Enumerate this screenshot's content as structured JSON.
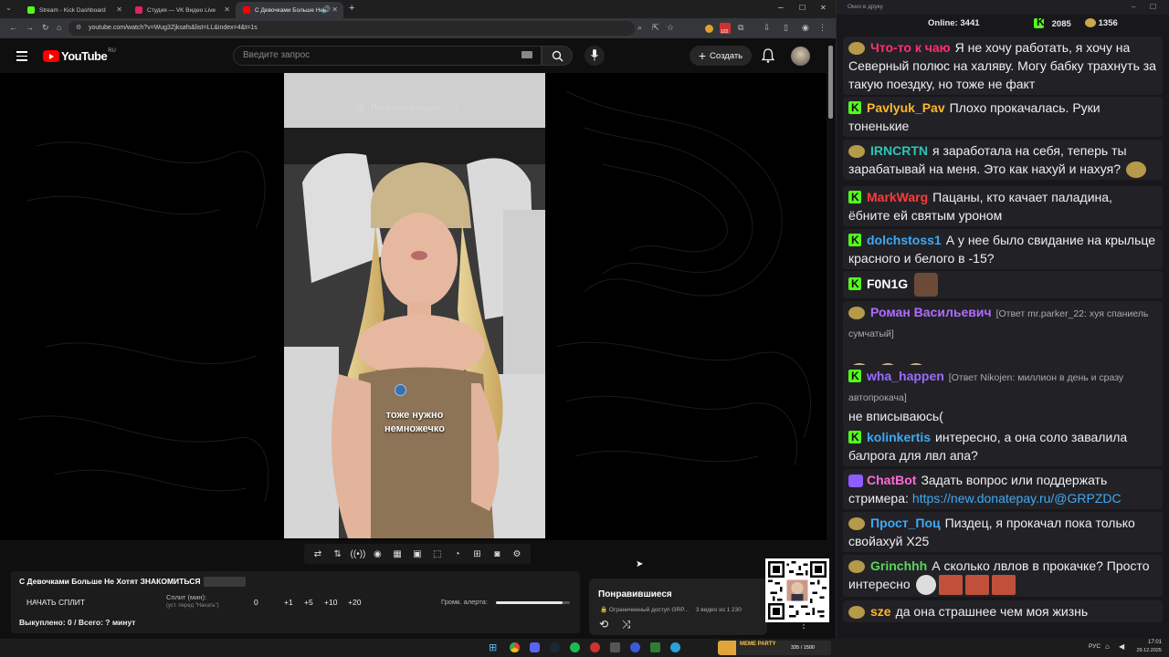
{
  "browser": {
    "tabs": [
      {
        "title": "Stream - Kick Dashboard",
        "color": "#53fc18"
      },
      {
        "title": "Студия — VK Видео Live",
        "color": "#e0245e"
      },
      {
        "title": "С Девочками Больше Не",
        "color": "#ff0000"
      }
    ],
    "url": "youtube.com/watch?v=Wug3Zjksafs&list=LL&index=4&t=1s",
    "ext_badge": "102"
  },
  "youtube": {
    "logo_text": "YouTube",
    "region": "RU",
    "search_placeholder": "Введите запрос",
    "create_label": "Создать",
    "translate_label": "Перевести видео",
    "caption_line1": "тоже нужно",
    "caption_line2": "немножечко"
  },
  "split_panel": {
    "title": "С Девочками Больше Не Хотят ЗНАКОМИТЬСЯ",
    "start_label": "НАЧАТЬ СПЛИТ",
    "split_label": "Сплит (мин):",
    "split_hint": "(уст. перед \"Начать\")",
    "split_value": "0",
    "plus1": "+1",
    "plus5": "+5",
    "plus10": "+10",
    "plus20": "+20",
    "volume_label": "Громк. алерта:",
    "volume_level": 0.9,
    "bought": "Выкуплено: 0 / Всего: ? минут"
  },
  "liked": {
    "title": "Понравившиеся",
    "access": "Ограниченный доступ",
    "owner": "GRP...",
    "count": "3 видео из 1 230"
  },
  "chat": {
    "title": "Окно в друку",
    "online_label": "Online:",
    "online": "3441",
    "kick_count": "2085",
    "other_count": "1356",
    "messages": [
      {
        "user": "Что-то к чаю",
        "color": "#ff2f6d",
        "badge": "emote",
        "text": "Я не хочу работать, я хочу на Северный полюс на халяву. Могу бабку трахнуть за такую поездку, но тоже не факт"
      },
      {
        "user": "Pavlyuk_Pav",
        "color": "#ffb72b",
        "badge": "kick",
        "text": "Плохо прокачалась. Руки тоненькие"
      },
      {
        "user": "IRNCRTN",
        "color": "#2ec4b6",
        "badge": "emote",
        "text": "я заработала на себя, теперь ты зарабатывай на меня. Это как нахуй и нахуя?"
      },
      {
        "user": "MarkWarg",
        "color": "#ff3b3b",
        "badge": "kick",
        "text": "Пацаны, кто качает паладина, ёбните ей святым уроном"
      },
      {
        "user": "dolchstoss1",
        "color": "#3fa9f5",
        "badge": "kick",
        "text": "А у нее было свидание на крыльце красного и белого в -15?"
      },
      {
        "user": "F0N1G",
        "color": "#ffffff",
        "badge": "kick",
        "text": ""
      },
      {
        "user": "Роман Васильевич",
        "color": "#b06bff",
        "badge": "emote",
        "reply": "[Ответ mr.parker_22: хуя спаниель сумчатый]",
        "text": ""
      },
      {
        "user": "wha_happen",
        "color": "#9b6bff",
        "badge": "kick",
        "reply": "[Ответ Nikojen: миллион в день и сразу автопрокача]",
        "text": "не вписываюсь("
      },
      {
        "user": "kolinkertis",
        "color": "#3fa9f5",
        "badge": "kick",
        "text": "интересно, а она соло завалила балрога для лвл апа?"
      },
      {
        "user": "ChatBot",
        "color": "#ff6bd6",
        "badge": "bot",
        "text": "Задать вопрос или поддержать стримера:",
        "link": "https://new.donatepay.ru/@GRPZDC"
      },
      {
        "user": "Прост_Поц",
        "color": "#3fa9f5",
        "badge": "emote",
        "text": "Пиздец, я прокачал пока только свойахуй X25"
      },
      {
        "user": "Grinchhh",
        "color": "#5cd65c",
        "badge": "emote",
        "text": "А сколько лвлов в прокачке? Просто интересно"
      },
      {
        "user": "sze",
        "color": "#ffb72b",
        "badge": "emote",
        "text": "да она страшнее чем моя жизнь"
      }
    ]
  },
  "taskbar": {
    "lang": "РУС",
    "time": "17:01",
    "date": "29.12.2025",
    "donation_label": "MEME PARTY",
    "donation_progress": "335 / 1500"
  }
}
